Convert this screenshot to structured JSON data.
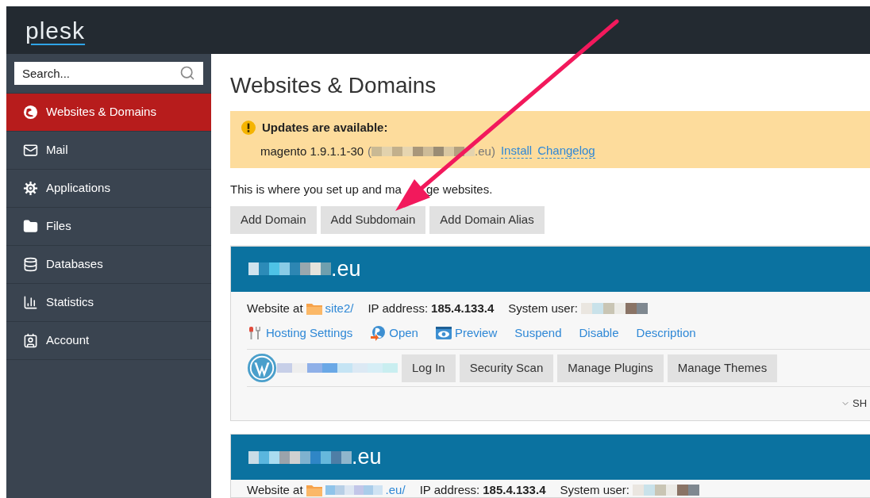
{
  "logo": "plesk",
  "search": {
    "placeholder": "Search..."
  },
  "sidebar": {
    "items": [
      {
        "label": "Websites & Domains",
        "selected": true
      },
      {
        "label": "Mail",
        "selected": false
      },
      {
        "label": "Applications",
        "selected": false
      },
      {
        "label": "Files",
        "selected": false
      },
      {
        "label": "Databases",
        "selected": false
      },
      {
        "label": "Statistics",
        "selected": false
      },
      {
        "label": "Account",
        "selected": false
      }
    ]
  },
  "page": {
    "title": "Websites & Domains"
  },
  "notice": {
    "title": "Updates are available:",
    "app": "magento 1.9.1.1-30",
    "domain_start": "(",
    "domain_end": ".eu)",
    "links": [
      "Install",
      "Changelog"
    ]
  },
  "intro": [
    "This is where you set up and ma",
    "ge websites."
  ],
  "actions": [
    "Add Domain",
    "Add Subdomain",
    "Add Domain Alias"
  ],
  "domains": [
    {
      "name_end": ".eu",
      "website_label": "Website at",
      "site": "site2/",
      "ip_label": "IP address:",
      "ip": "185.4.133.4",
      "user_label": "System user:",
      "links": [
        "Hosting Settings",
        "Open",
        "Preview",
        "Suspend",
        "Disable",
        "Description"
      ],
      "wordpress_buttons": [
        "Log In",
        "Security Scan",
        "Manage Plugins",
        "Manage Themes"
      ],
      "toggle": "SH"
    },
    {
      "name_end": ".eu",
      "website_label": "Website at",
      "site": ".eu/",
      "ip_label": "IP address:",
      "ip": "185.4.133.4",
      "user_label": "System user:"
    }
  ]
}
